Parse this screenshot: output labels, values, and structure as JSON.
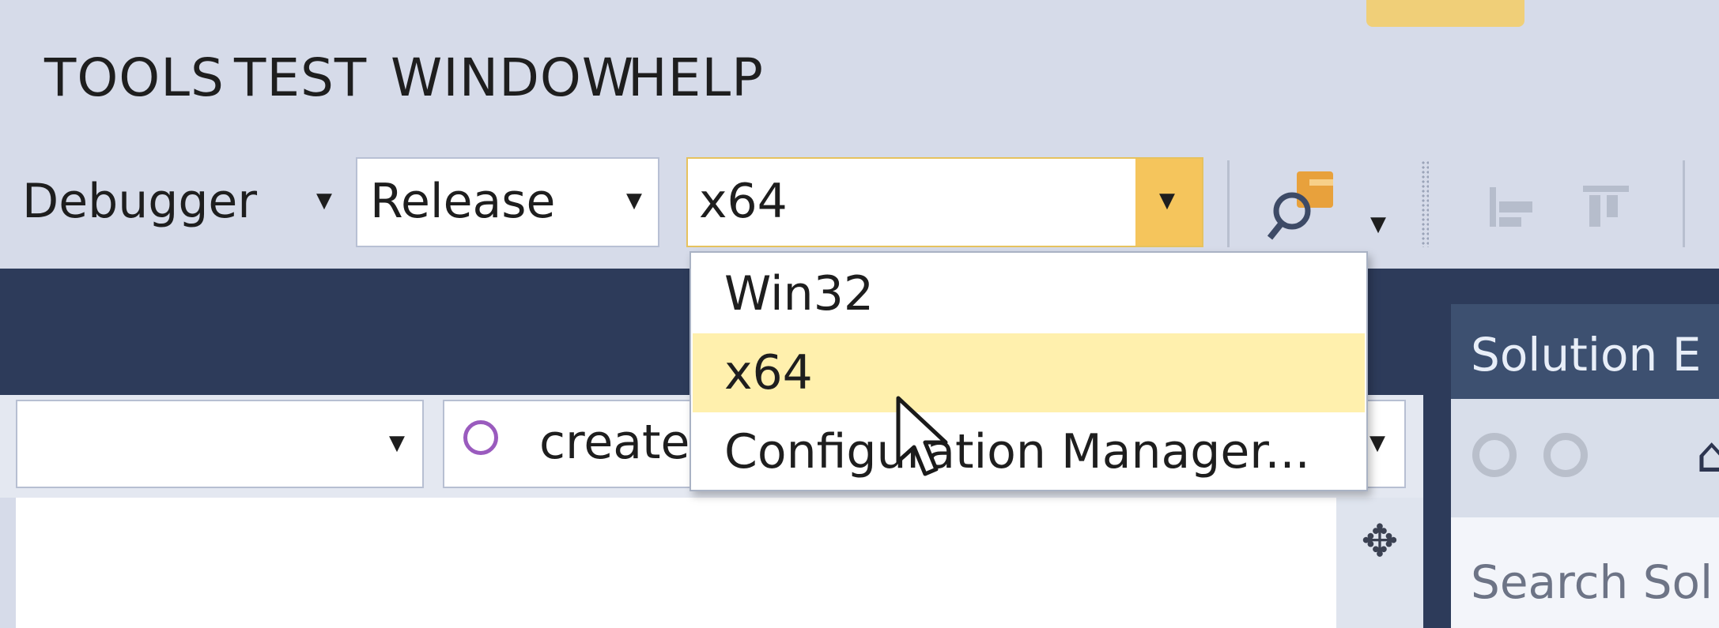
{
  "menubar": {
    "items": [
      "TOOLS",
      "TEST",
      "WINDOW",
      "HELP"
    ]
  },
  "toolbar": {
    "debugger_label": "Debugger",
    "configuration": "Release",
    "platform": "x64"
  },
  "platform_dropdown": {
    "options": [
      "Win32",
      "x64",
      "Configuration Manager..."
    ],
    "highlighted_index": 1
  },
  "navigation": {
    "member_label": "create"
  },
  "solution_explorer": {
    "title": "Solution E",
    "search_placeholder": "Search Sol"
  },
  "colors": {
    "accent": "#f5c55c",
    "highlight": "#fff0ad",
    "dark_band": "#2d3b5a"
  },
  "icons": [
    "find-in-files-icon",
    "home-icon",
    "back-icon",
    "forward-icon",
    "splitter-icon",
    "method-icon",
    "mouse-cursor-icon"
  ]
}
